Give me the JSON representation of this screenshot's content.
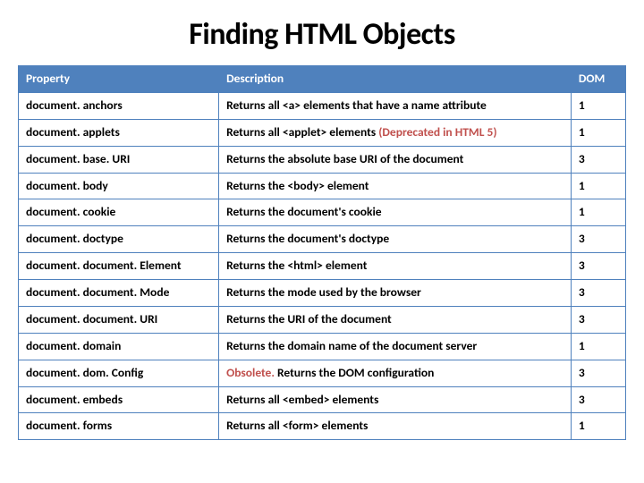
{
  "title": "Finding HTML Objects",
  "columns": {
    "property": "Property",
    "description": "Description",
    "dom": "DOM"
  },
  "rows": [
    {
      "property": "document. anchors",
      "description": "Returns all <a> elements that have a name attribute",
      "dom": "1"
    },
    {
      "property": "document. applets",
      "description_pre": "Returns all <applet> elements ",
      "note": "(Deprecated in HTML 5)",
      "note_class": "deprecated",
      "dom": "1"
    },
    {
      "property": "document. base. URI",
      "description": "Returns the absolute base URI of the document",
      "dom": "3"
    },
    {
      "property": "document. body",
      "description": "Returns the <body> element",
      "dom": "1"
    },
    {
      "property": "document. cookie",
      "description": "Returns the document's cookie",
      "dom": "1"
    },
    {
      "property": "document. doctype",
      "description": "Returns the document's doctype",
      "dom": "3"
    },
    {
      "property": "document. document. Element",
      "description": "Returns the <html> element",
      "dom": "3"
    },
    {
      "property": "document. document. Mode",
      "description": "Returns the mode used by the browser",
      "dom": "3"
    },
    {
      "property": "document. document. URI",
      "description": "Returns the URI of the document",
      "dom": "3"
    },
    {
      "property": "document. domain",
      "description": "Returns the domain name of the document server",
      "dom": "1"
    },
    {
      "property": "document. dom. Config",
      "note": "Obsolete.",
      "note_class": "obsolete",
      "description_post": " Returns the DOM configuration",
      "dom": "3"
    },
    {
      "property": "document. embeds",
      "description": "Returns all <embed> elements",
      "dom": "3"
    },
    {
      "property": "document. forms",
      "description": "Returns all <form> elements",
      "dom": "1"
    }
  ]
}
